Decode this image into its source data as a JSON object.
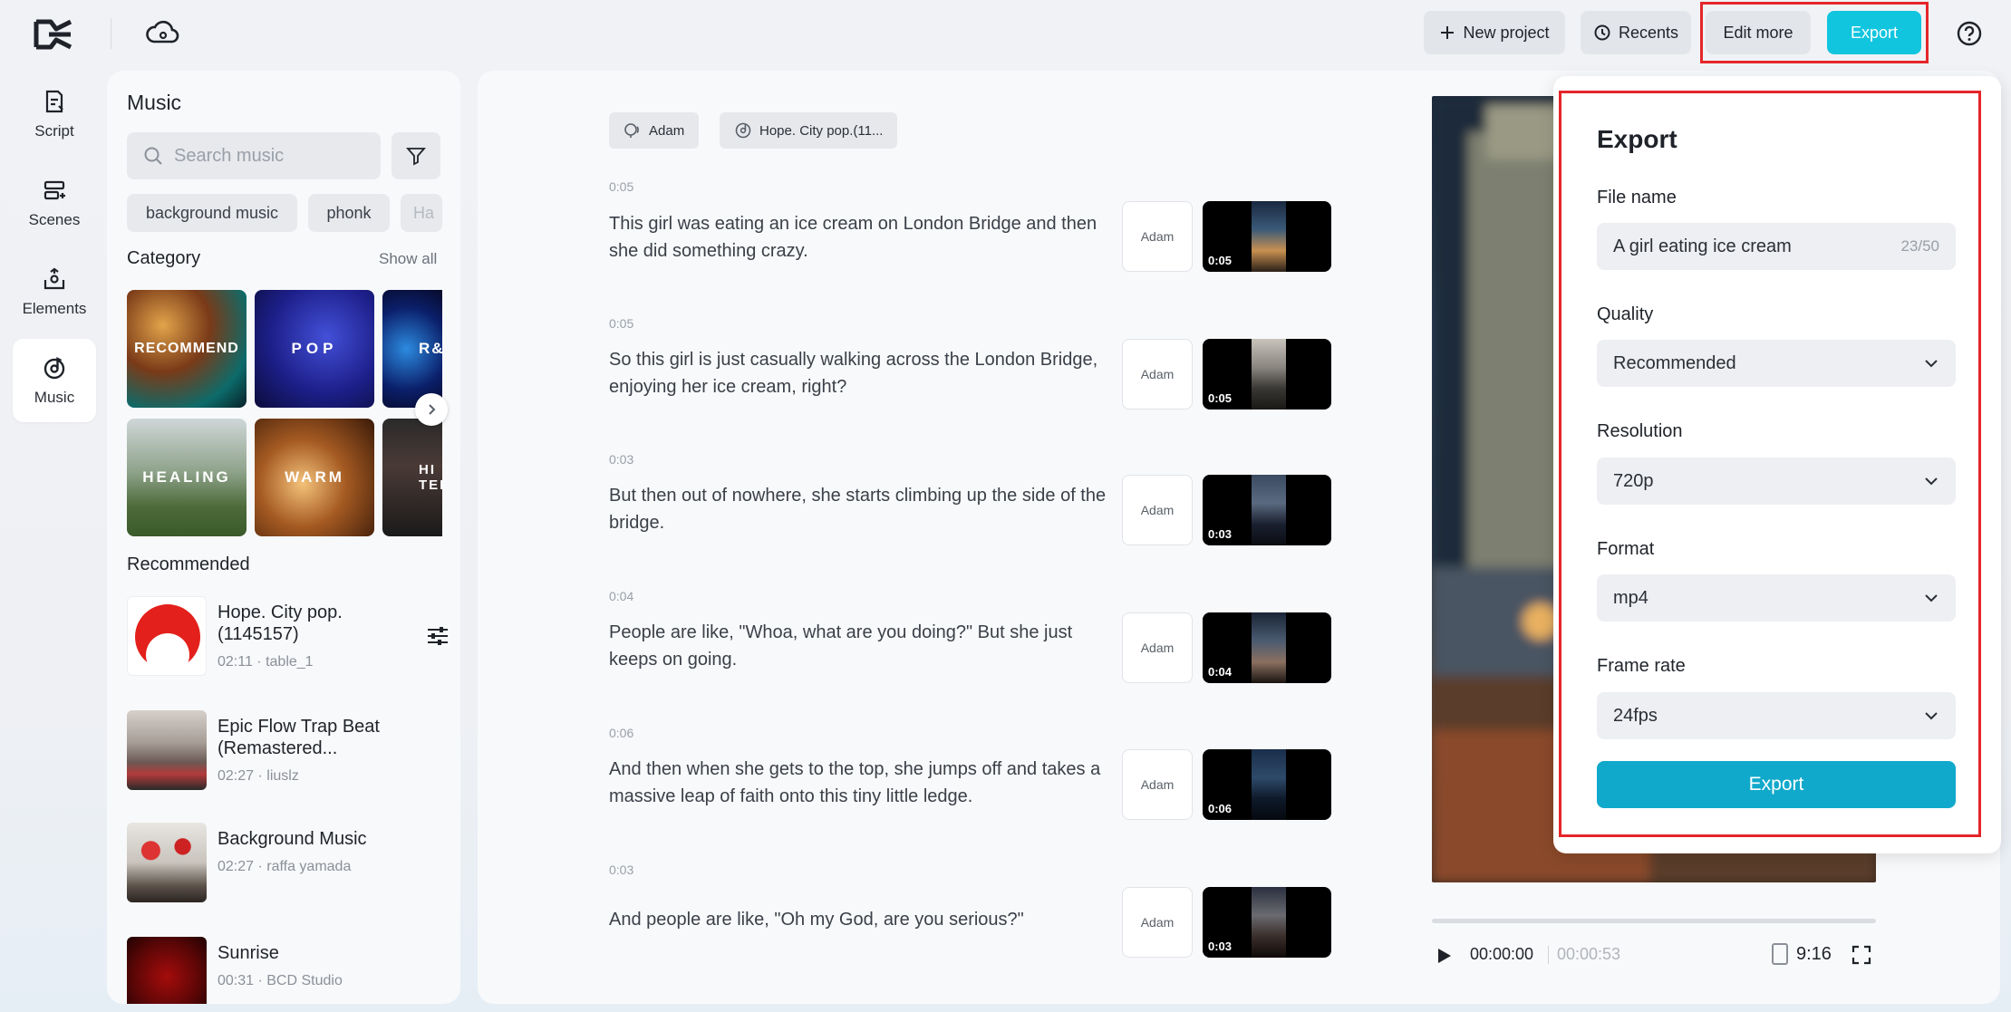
{
  "topbar": {
    "new_project": "New project",
    "recents": "Recents",
    "edit_more": "Edit more",
    "export": "Export"
  },
  "rail": {
    "items": [
      {
        "label": "Script",
        "icon": "script-icon"
      },
      {
        "label": "Scenes",
        "icon": "scenes-icon"
      },
      {
        "label": "Elements",
        "icon": "elements-icon"
      },
      {
        "label": "Music",
        "icon": "music-icon",
        "active": true
      }
    ]
  },
  "music": {
    "title": "Music",
    "search_placeholder": "Search music",
    "chips": [
      "background music",
      "phonk",
      "Ha"
    ],
    "category_title": "Category",
    "show_all": "Show all",
    "categories": [
      "RECOMMEND",
      "POP",
      "R&",
      "HEALING",
      "WARM",
      "HI TEM"
    ],
    "recommended_title": "Recommended",
    "tracks": [
      {
        "title": "Hope. City pop. (1145157)",
        "meta": "02:11 · table_1"
      },
      {
        "title": "Epic Flow Trap Beat (Remastered...",
        "meta": "02:27 · liuslz"
      },
      {
        "title": "Background Music",
        "meta": "02:27 · raffa yamada"
      },
      {
        "title": "Sunrise",
        "meta": "00:31 · BCD Studio"
      }
    ]
  },
  "script": {
    "voice_tag": "Adam",
    "music_tag": "Hope. City pop.(11...",
    "segments": [
      {
        "time": "0:05",
        "text": "This girl was eating an ice cream on London Bridge and then she did something crazy.",
        "voice": "Adam",
        "dur": "0:05"
      },
      {
        "time": "0:05",
        "text": "So this girl is just casually walking across the London Bridge, enjoying her ice cream, right?",
        "voice": "Adam",
        "dur": "0:05"
      },
      {
        "time": "0:03",
        "text": "But then out of nowhere, she starts climbing up the side of the bridge.",
        "voice": "Adam",
        "dur": "0:03"
      },
      {
        "time": "0:04",
        "text": "People are like, \"Whoa, what are you doing?\" But she just keeps on going.",
        "voice": "Adam",
        "dur": "0:04"
      },
      {
        "time": "0:06",
        "text": "And then when she gets to the top, she jumps off and takes a massive leap of faith onto this tiny little ledge.",
        "voice": "Adam",
        "dur": "0:06"
      },
      {
        "time": "0:03",
        "text": "And people are like, \"Oh my God, are you serious?\"",
        "voice": "Adam",
        "dur": "0:03"
      }
    ]
  },
  "player": {
    "current": "00:00:00",
    "total": "00:00:53",
    "ratio": "9:16",
    "progress": 0
  },
  "export_dialog": {
    "title": "Export",
    "file_name_label": "File name",
    "file_name": "A girl eating ice cream",
    "file_name_count": "23/50",
    "quality_label": "Quality",
    "quality": "Recommended",
    "resolution_label": "Resolution",
    "resolution": "720p",
    "format_label": "Format",
    "format": "mp4",
    "frame_rate_label": "Frame rate",
    "frame_rate": "24fps",
    "export_button": "Export"
  },
  "colors": {
    "accent": "#11c5df",
    "export_button": "#11a9cb",
    "highlight": "#e5262a"
  }
}
